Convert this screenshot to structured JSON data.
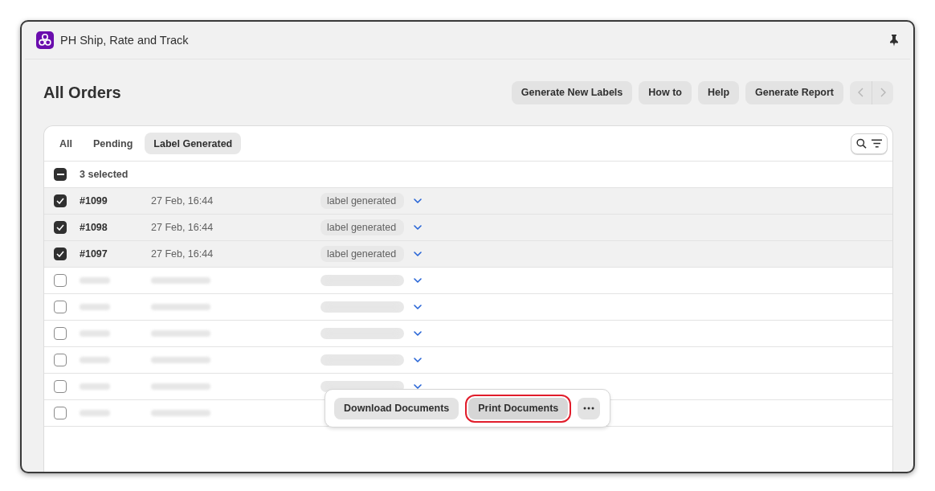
{
  "app": {
    "title": "PH Ship, Rate and Track"
  },
  "page": {
    "title": "All Orders"
  },
  "actions": [
    {
      "label": "Generate New Labels"
    },
    {
      "label": "How to"
    },
    {
      "label": "Help"
    },
    {
      "label": "Generate Report"
    }
  ],
  "pager": [
    {
      "kind": "prev",
      "disabled": true
    },
    {
      "kind": "next",
      "disabled": true
    }
  ],
  "tabs": [
    {
      "label": "All",
      "selected": false
    },
    {
      "label": "Pending",
      "selected": false
    },
    {
      "label": "Label Generated",
      "selected": true
    }
  ],
  "select_all": {
    "label": "3 selected",
    "indeterminate": true
  },
  "rows": [
    {
      "order": "#1099",
      "date": "27 Feb, 16:44",
      "status": "label generated",
      "selected": true,
      "redacted": false
    },
    {
      "order": "#1098",
      "date": "27 Feb, 16:44",
      "status": "label generated",
      "selected": true,
      "redacted": false
    },
    {
      "order": "#1097",
      "date": "27 Feb, 16:44",
      "status": "label generated",
      "selected": true,
      "redacted": false
    },
    {
      "selected": false,
      "redacted": true
    },
    {
      "selected": false,
      "redacted": true
    },
    {
      "selected": false,
      "redacted": true
    },
    {
      "selected": false,
      "redacted": true
    },
    {
      "selected": false,
      "redacted": true
    },
    {
      "selected": false,
      "redacted": true,
      "status_hidden": true
    }
  ],
  "bulk_actions": [
    {
      "kind": "button",
      "label": "Download Documents",
      "highlighted": false
    },
    {
      "kind": "button",
      "label": "Print Documents",
      "highlighted": true
    },
    {
      "kind": "more",
      "highlighted": false
    }
  ]
}
